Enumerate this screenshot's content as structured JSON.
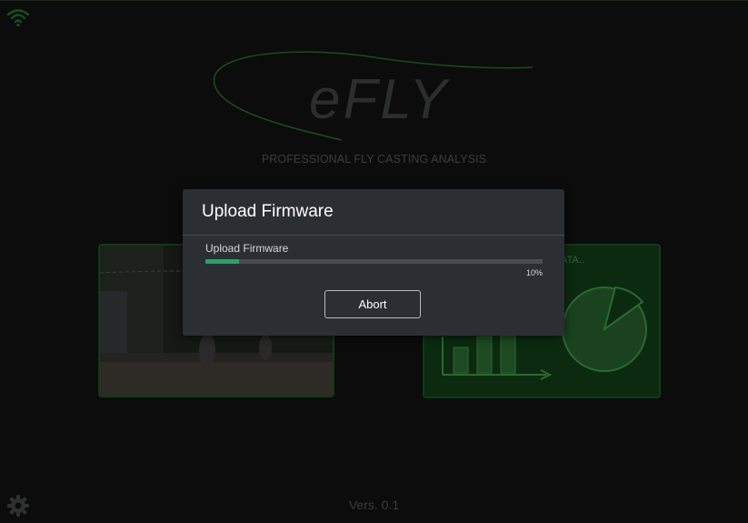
{
  "app": {
    "logo_text": "eFLY",
    "tagline": "PROFESSIONAL FLY CASTING ANALYSIS",
    "version": "Vers. 0.1"
  },
  "cards": {
    "right_label": "ATA.."
  },
  "dialog": {
    "title": "Upload Firmware",
    "progress_label": "Upload Firmware",
    "progress_fraction": 0.1,
    "progress_text": "10%",
    "abort_label": "Abort"
  },
  "icons": {
    "wifi": "wifi-icon",
    "settings": "gear-icon"
  },
  "colors": {
    "accent": "#2f9e67",
    "brand_green": "#1f5a25",
    "dialog_bg": "#2b2e33"
  }
}
